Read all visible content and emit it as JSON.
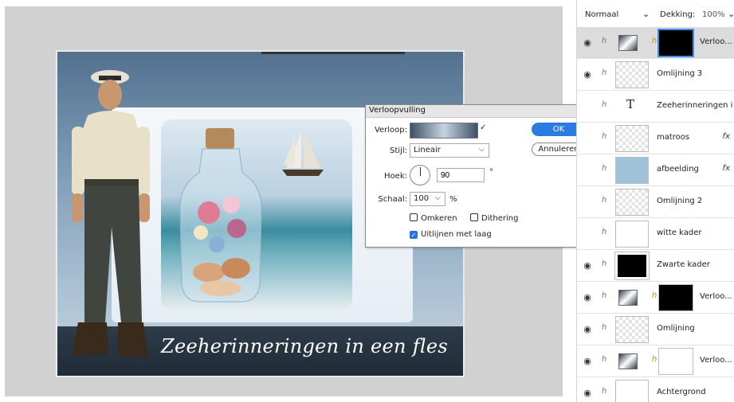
{
  "dialog": {
    "title": "Verloopvulling",
    "close_glyph": "×",
    "gradient_label": "Verloop:",
    "style_label": "Stijl:",
    "style_value": "Lineair",
    "angle_label": "Hoek:",
    "angle_value": "90",
    "degree_sign": "°",
    "scale_label": "Schaal:",
    "scale_value": "100",
    "percent_sign": "%",
    "reverse_label": "Omkeren",
    "dither_label": "Dithering",
    "align_label": "Uitlijnen met laag",
    "reverse_checked": false,
    "dither_checked": false,
    "align_checked": true,
    "ok_label": "OK",
    "cancel_label": "Annuleren",
    "accent_color": "#2b7be4"
  },
  "canvas": {
    "artwork_text": "Zeeherinneringen in een fles"
  },
  "layers_panel": {
    "blend_mode": "Normaal",
    "opacity_label": "Dekking:",
    "opacity_value": "100%",
    "layers": [
      {
        "name": "Verloo...",
        "thumb": "adjustment",
        "mask": "black",
        "selected": true,
        "visible": true
      },
      {
        "name": "Omlijning 3",
        "thumb": "transparent",
        "visible": true
      },
      {
        "name": "Zeeherinneringen i...",
        "thumb": "text",
        "visible": false
      },
      {
        "name": "matroos",
        "thumb": "transparent",
        "fx": true,
        "visible": false
      },
      {
        "name": "afbeelding",
        "thumb": "image",
        "fx": true,
        "visible": false
      },
      {
        "name": "Omlijning 2",
        "thumb": "transparent",
        "visible": false
      },
      {
        "name": "witte kader",
        "thumb": "white",
        "visible": false
      },
      {
        "name": "Zwarte kader",
        "thumb": "black-frame",
        "visible": true
      },
      {
        "name": "Verloo...",
        "thumb": "adjustment",
        "mask": "black",
        "visible": true
      },
      {
        "name": "Omlijning",
        "thumb": "transparent",
        "visible": true
      },
      {
        "name": "Verloo...",
        "thumb": "adjustment",
        "mask": "white",
        "visible": true
      },
      {
        "name": "Achtergrond",
        "thumb": "white",
        "visible": true
      }
    ],
    "fx_label": "fx",
    "type_glyph": "T"
  }
}
